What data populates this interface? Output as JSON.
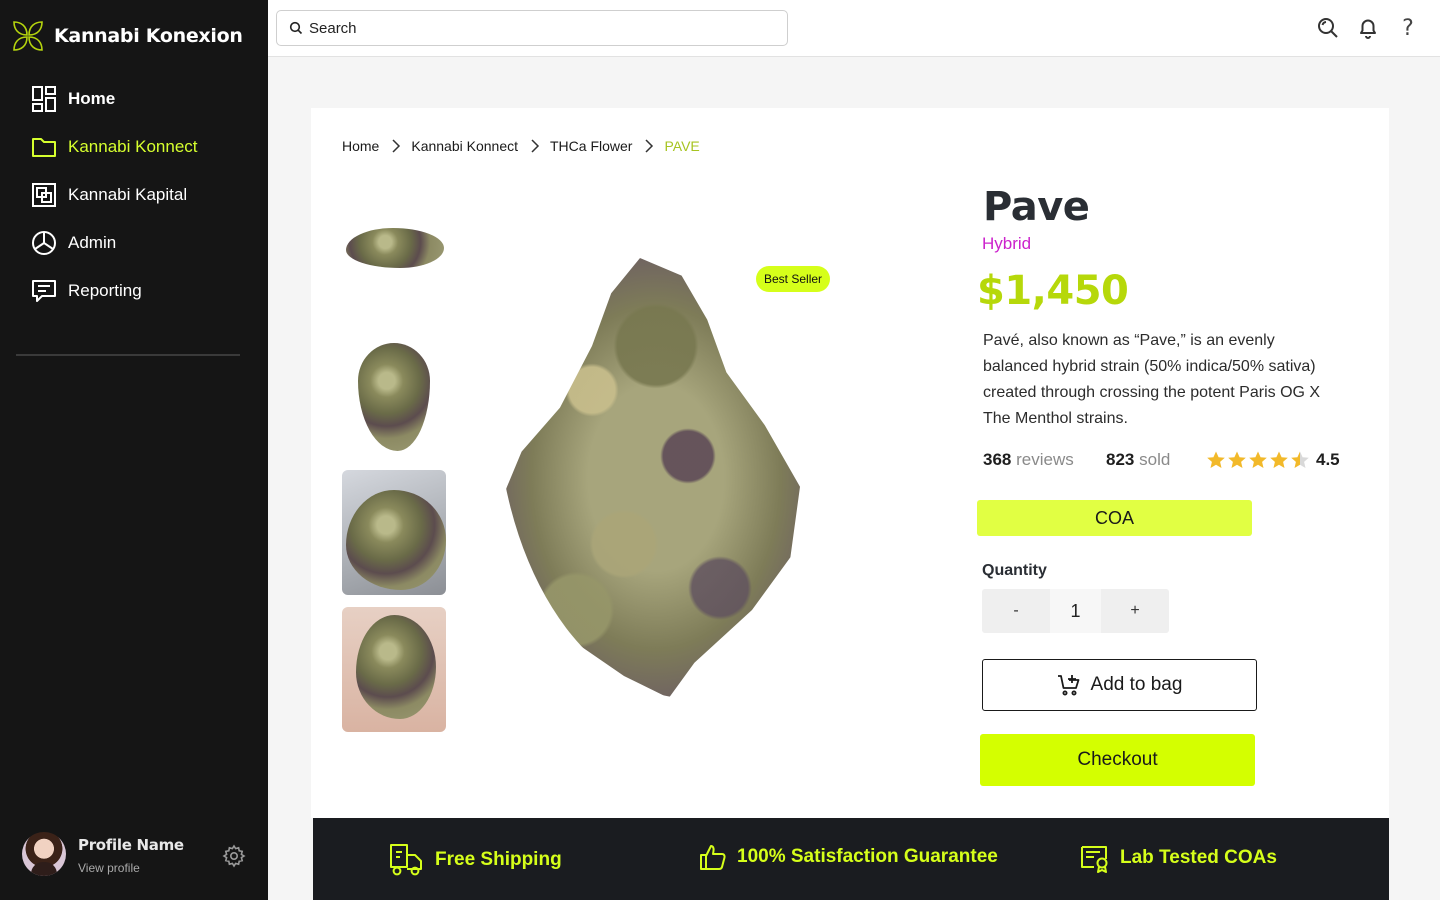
{
  "brand": {
    "name": "Kannabi Konexion"
  },
  "sidebar": {
    "items": [
      {
        "label": "Home",
        "icon": "dashboard-icon"
      },
      {
        "label": "Kannabi Konnect",
        "icon": "folder-icon"
      },
      {
        "label": "Kannabi Kapital",
        "icon": "kapital-icon"
      },
      {
        "label": "Admin",
        "icon": "pie-chart-icon"
      },
      {
        "label": "Reporting",
        "icon": "message-icon"
      }
    ],
    "profile": {
      "name": "Profile Name",
      "sub": "View profile"
    }
  },
  "topbar": {
    "search_placeholder": "Search"
  },
  "breadcrumb": [
    "Home",
    "Kannabi Konnect",
    "THCa Flower",
    "PAVE"
  ],
  "product": {
    "badge": "Best Seller",
    "title": "Pave",
    "strain_type": "Hybrid",
    "price": "$1,450",
    "description": "Pavé, also known as “Pave,” is an evenly balanced hybrid strain (50% indica/50% sativa) created through crossing the potent Paris OG X The Menthol strains.",
    "reviews_count": "368",
    "reviews_label": "reviews",
    "sold_count": "823",
    "sold_label": "sold",
    "rating": "4.5",
    "rating_value": 4.5,
    "coa_label": "COA",
    "quantity_label": "Quantity",
    "quantity_minus": "-",
    "quantity_value": "1",
    "quantity_plus": "+",
    "add_to_bag": "Add to bag",
    "checkout": "Checkout"
  },
  "features": [
    {
      "label": "Free Shipping",
      "icon": "delivery-truck-icon"
    },
    {
      "label": "100% Satisfaction Guarantee",
      "icon": "thumbs-up-icon"
    },
    {
      "label": "Lab Tested COAs",
      "icon": "certificate-icon"
    }
  ],
  "colors": {
    "accent": "#d4ff00",
    "sidebar_bg": "#151515",
    "price": "#b6d80a",
    "strain": "#cc22cc",
    "features_bg": "#1a1c20"
  }
}
